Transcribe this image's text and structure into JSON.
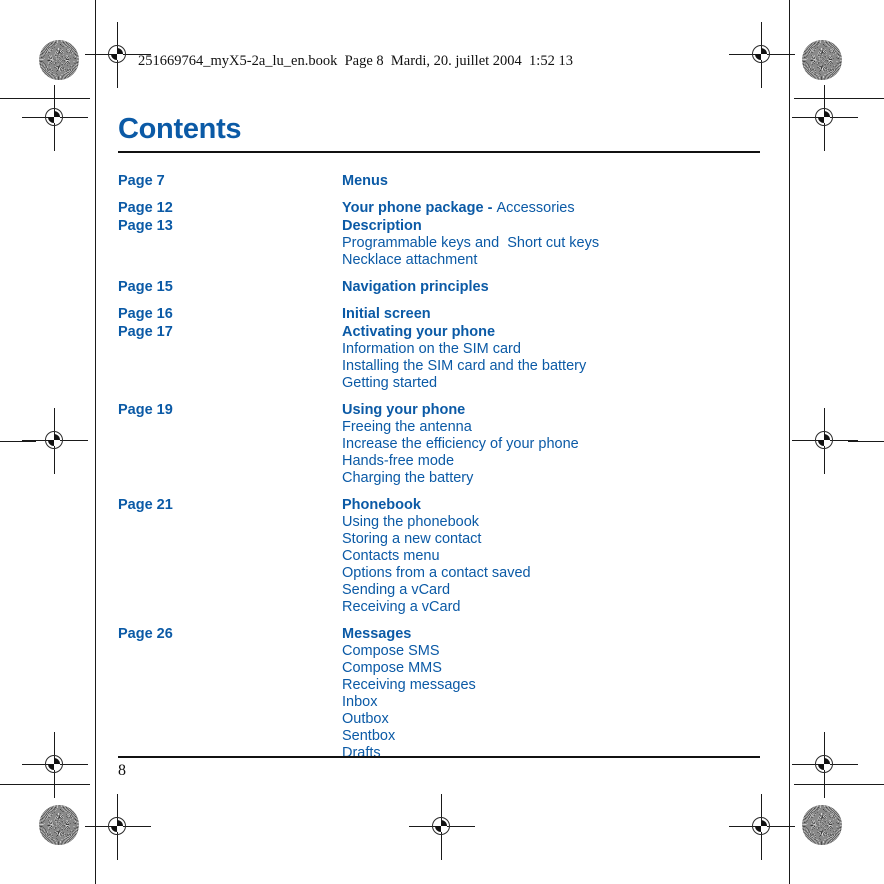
{
  "print_marks": {
    "file_stamp": "251669764_myX5-2a_lu_en.book  Page 8  Mardi, 20. juillet 2004  1:52 13",
    "registration_icon": "registration-target-icon",
    "starburst_icon": "print-density-starburst-icon"
  },
  "document": {
    "title": "Contents",
    "accent_color": "#0b5aa6",
    "rule_color": "#111111",
    "folio": "8"
  },
  "toc": {
    "entries": [
      {
        "page": "Page 7",
        "heading": "Menus",
        "heading_suffix": "",
        "subitems": []
      },
      {
        "page": "Page 12",
        "heading": "Your phone package - ",
        "heading_suffix": "Accessories",
        "subitems": []
      },
      {
        "page": "Page 13",
        "heading": "Description",
        "heading_suffix": "",
        "subitems": [
          "Programmable keys and  Short cut keys",
          "Necklace attachment"
        ]
      },
      {
        "page": "Page 15",
        "heading": "Navigation principles",
        "heading_suffix": "",
        "subitems": []
      },
      {
        "page": "Page 16",
        "heading": "Initial screen",
        "heading_suffix": "",
        "subitems": []
      },
      {
        "page": "Page 17",
        "heading": "Activating your phone",
        "heading_suffix": "",
        "subitems": [
          "Information on the SIM card",
          "Installing the SIM card and the battery",
          "Getting started"
        ]
      },
      {
        "page": "Page 19",
        "heading": "Using your phone",
        "heading_suffix": "",
        "subitems": [
          "Freeing the antenna",
          "Increase the efficiency of your phone",
          "Hands-free mode",
          "Charging the battery"
        ]
      },
      {
        "page": "Page 21",
        "heading": "Phonebook",
        "heading_suffix": "",
        "subitems": [
          "Using the phonebook",
          "Storing a new contact",
          "Contacts menu",
          "Options from a contact saved",
          "Sending a vCard",
          "Receiving a vCard"
        ]
      },
      {
        "page": "Page 26",
        "heading": "Messages",
        "heading_suffix": "",
        "subitems": [
          "Compose SMS",
          "Compose MMS",
          "Receiving messages",
          "Inbox",
          "Outbox",
          "Sentbox",
          "Drafts"
        ]
      }
    ]
  }
}
